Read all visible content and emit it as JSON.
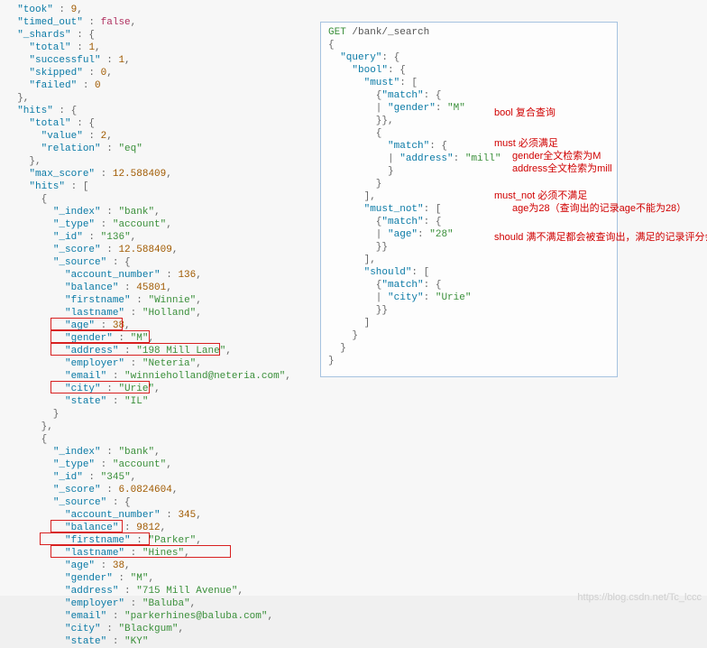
{
  "response": {
    "took": 9,
    "timed_out": false,
    "shards": {
      "total": 1,
      "successful": 1,
      "skipped": 0,
      "failed": 0
    },
    "hits": {
      "total": {
        "value": 2,
        "relation": "eq"
      },
      "max_score": 12.588409
    },
    "hits_records": [
      {
        "_index": "bank",
        "_type": "account",
        "_id": "136",
        "_score": 12.588409,
        "_source": {
          "account_number": 136,
          "balance": 45801,
          "firstname": "Winnie",
          "lastname": "Holland",
          "age": 38,
          "gender": "M",
          "address": "198 Mill Lane",
          "employer": "Neteria",
          "email": "winnieholland@neteria.com",
          "city": "Urie",
          "state": "IL"
        }
      },
      {
        "_index": "bank",
        "_type": "account",
        "_id": "345",
        "_score": 6.0824604,
        "_source": {
          "account_number": 345,
          "balance": 9812,
          "firstname": "Parker",
          "lastname": "Hines",
          "age": 38,
          "gender": "M",
          "address": "715 Mill Avenue",
          "employer": "Baluba",
          "email": "parkerhines@baluba.com",
          "city": "Blackgum",
          "state": "KY"
        }
      }
    ]
  },
  "request": {
    "method": "GET",
    "path": "/bank/_search",
    "must_gender": "M",
    "must_address": "mill",
    "must_not_age": "28",
    "should_city": "Urie"
  },
  "annotations": {
    "bool_title": "bool 复合查询",
    "must_title": "must 必须满足",
    "must_l1": "gender全文检索为M",
    "must_l2": "address全文检索为mill",
    "mustnot_title": "must_not 必须不满足",
    "mustnot_l1": "age为28（查询出的记录age不能为28）",
    "should_title": "should  满不满足都会被查询出，满足的记录评分会更高"
  },
  "watermark": "https://blog.csdn.net/Tc_lccc"
}
